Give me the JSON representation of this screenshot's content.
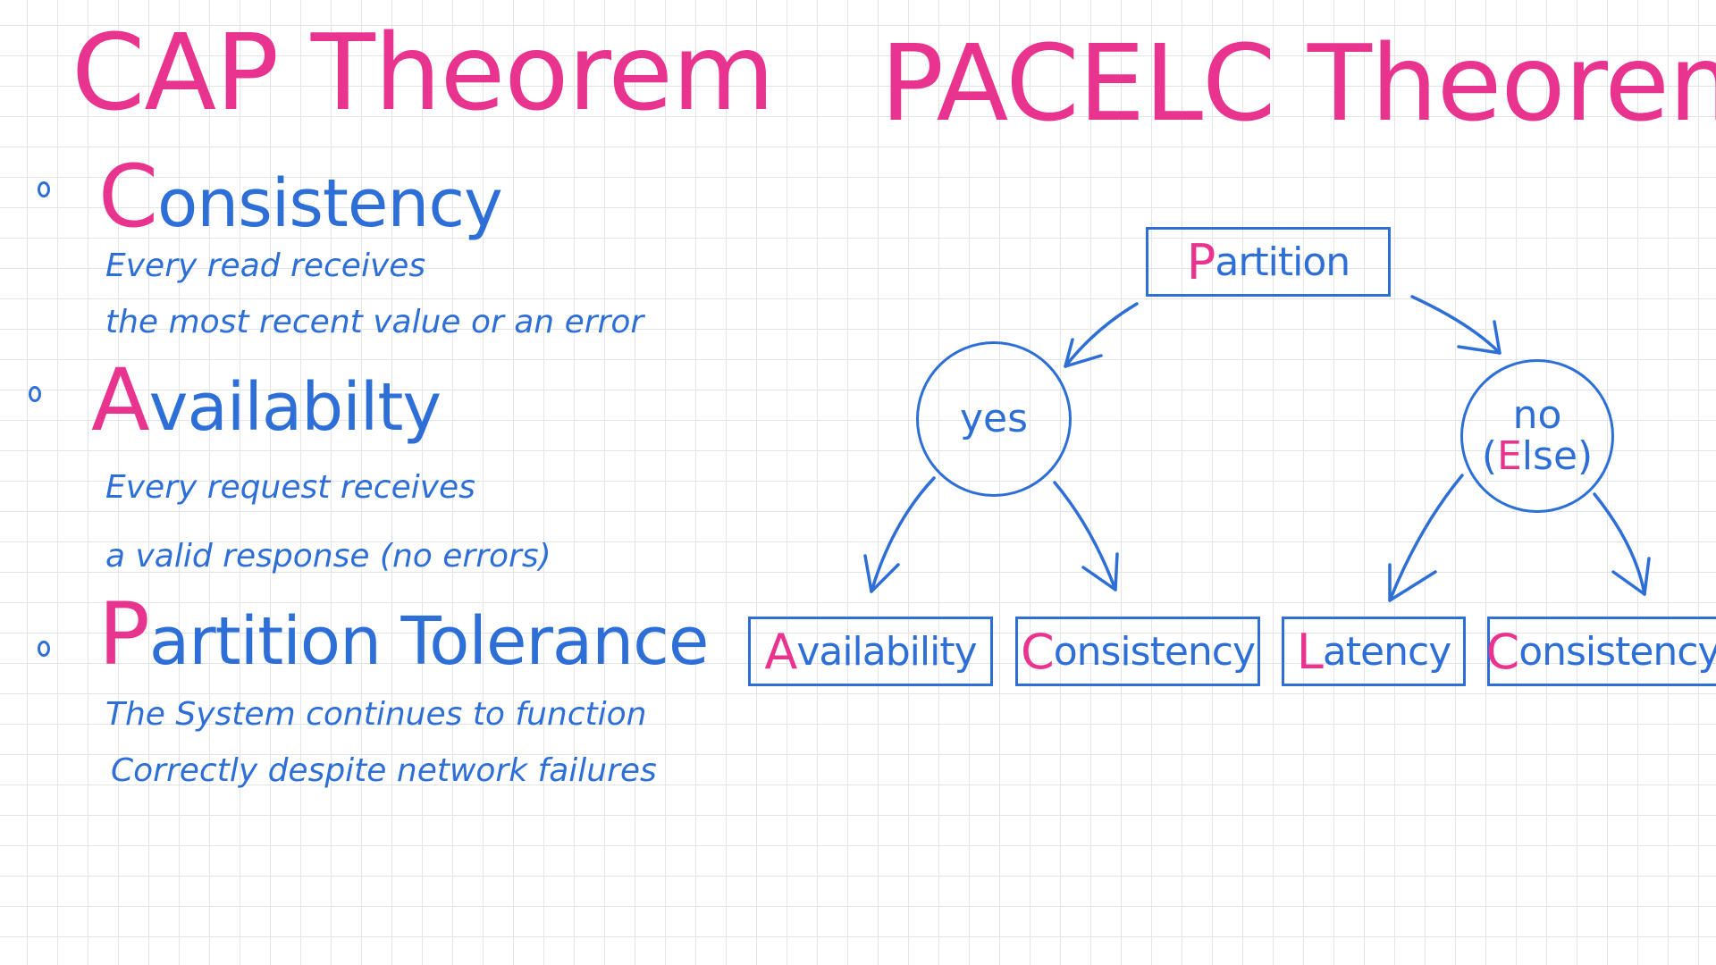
{
  "cap": {
    "title": "CAP Theorem",
    "items": [
      {
        "heading_first": "C",
        "heading_rest": "onsistency",
        "desc_line1": "Every read receives",
        "desc_line2": "the most recent value or an error"
      },
      {
        "heading_first": "A",
        "heading_rest": "vailabilty",
        "desc_line1": "Every request receives",
        "desc_line2": "a valid response (no errors)"
      },
      {
        "heading_first": "P",
        "heading_rest": "artition Tolerance",
        "desc_line1": "The System continues to function",
        "desc_line2": "Correctly despite network failures"
      }
    ]
  },
  "pacelc": {
    "title": "PACELC Theorem",
    "root": {
      "first": "P",
      "rest": "artition"
    },
    "yes_node": {
      "label": "yes"
    },
    "no_node": {
      "line1": "no",
      "open": "(",
      "first": "E",
      "rest": "lse)"
    },
    "leaves": [
      {
        "first": "A",
        "rest": "vailability"
      },
      {
        "first": "C",
        "rest": "onsistency"
      },
      {
        "first": "L",
        "rest": "atency"
      },
      {
        "first": "C",
        "rest": "onsistency"
      }
    ]
  },
  "colors": {
    "accent_pink": "#e8338f",
    "ink_blue": "#2d6fd6",
    "grid": "#e4e4e4"
  }
}
